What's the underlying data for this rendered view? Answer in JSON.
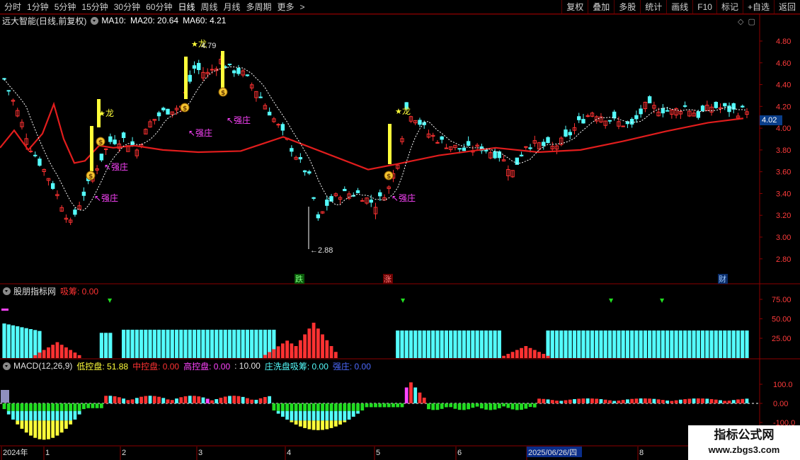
{
  "toolbar": {
    "periods": [
      "分时",
      "1分钟",
      "5分钟",
      "15分钟",
      "30分钟",
      "60分钟",
      "日线",
      "周线",
      "月线",
      "多周期",
      "更多"
    ],
    "more_arrow": ">",
    "right_tools": [
      "复权",
      "叠加",
      "多股",
      "统计",
      "画线",
      "F10",
      "标记",
      "+自选",
      "返回"
    ]
  },
  "main_panel": {
    "title": "远大智能(日线,前复权)",
    "ma10_label": "MA10:",
    "ma20_label": "MA20: 20.64",
    "ma60_label": "MA60: 4.21",
    "y_ticks": [
      "4.80",
      "4.60",
      "4.40",
      "4.20",
      "4.00",
      "3.80",
      "3.60",
      "3.40",
      "3.20",
      "3.00",
      "2.80"
    ],
    "last_price": "4.02",
    "high_label": "4.79",
    "low_label": "2.88",
    "tags": {
      "dragon": "龙",
      "strong": "强庄",
      "fall": "跌",
      "rise": "涨",
      "fin": "财"
    }
  },
  "indicator_panel": {
    "title": "股朋指标网",
    "absorb_label": "吸筹: 0.00",
    "y_ticks": [
      "75.00",
      "50.00",
      "25.00"
    ]
  },
  "macd_panel": {
    "title": "MACD(12,26,9)",
    "low": "低控盘: 51.88",
    "mid": "中控盘: 0.00",
    "high": "高控盘: 0.00",
    "sep": ": 10.00",
    "wash": "庄洗盘吸筹: 0.00",
    "strong": "强庄: 0.00",
    "y_ticks": [
      "100.0",
      "0.00",
      "-100.0"
    ]
  },
  "x_axis": {
    "labels": [
      "2024年",
      "1",
      "2",
      "3",
      "4",
      "5",
      "6",
      "2025/06/26/四",
      "8"
    ]
  },
  "watermark": {
    "title": "指标公式网",
    "url": "www.zbgs3.com"
  },
  "colors": {
    "up": "#ff3232",
    "down": "#54fcfc",
    "ma": "#e11d1d",
    "yellow": "#ffff3a",
    "magenta": "#ff44ff",
    "green": "#22dd22",
    "gridline": "#8b0000"
  }
}
